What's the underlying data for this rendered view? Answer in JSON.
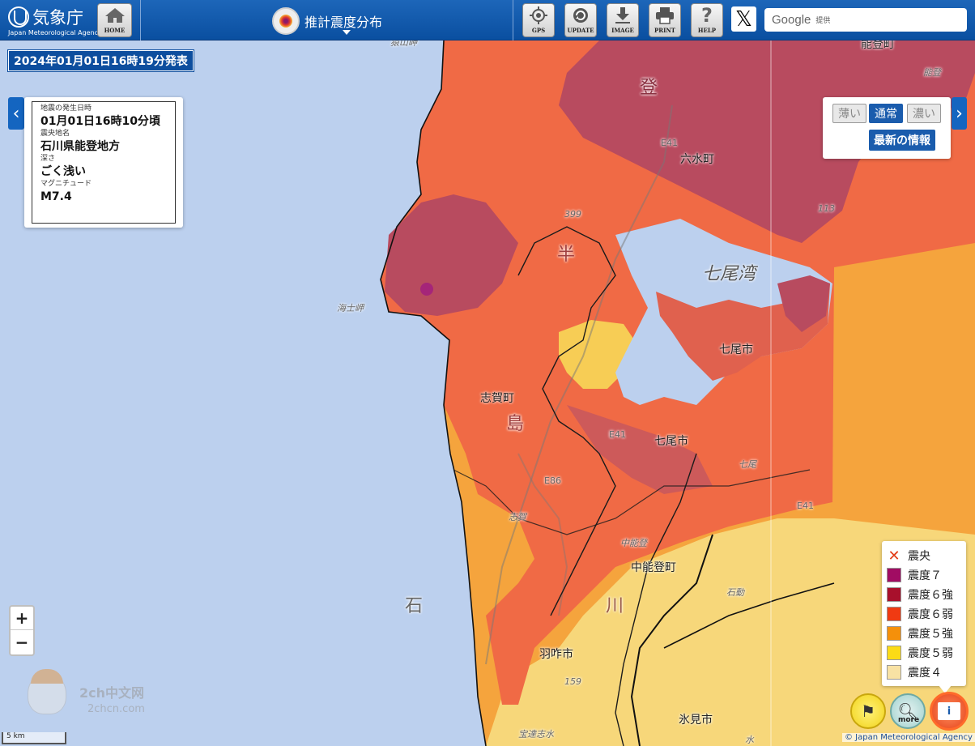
{
  "header": {
    "agency_name": "気象庁",
    "agency_name_en": "Japan Meteorological Agency",
    "home_label": "HOME",
    "title": "推計震度分布",
    "tools": [
      {
        "label": "GPS",
        "icon": "gps-icon"
      },
      {
        "label": "UPDATE",
        "icon": "update-icon"
      },
      {
        "label": "IMAGE",
        "icon": "download-icon"
      },
      {
        "label": "PRINT",
        "icon": "print-icon"
      },
      {
        "label": "HELP",
        "icon": "help-icon"
      }
    ],
    "x_icon": "x-logo-icon",
    "search_brand": "Google",
    "search_suffix": "提供"
  },
  "issued_at": "2024年01月01日16時19分発表",
  "quake": {
    "time_label": "地震の発生日時",
    "time_value": "01月01日16時10分頃",
    "epicenter_label": "震央地名",
    "epicenter_value": "石川県能登地方",
    "depth_label": "深さ",
    "depth_value": "ごく浅い",
    "magnitude_label": "マグニチュード",
    "magnitude_value": "M7.4"
  },
  "shade": {
    "light": "薄い",
    "normal": "通常",
    "dark": "濃い",
    "selected": "通常",
    "latest": "最新の情報"
  },
  "zoom": {
    "in": "+",
    "out": "−"
  },
  "map_labels": {
    "anamizu": "六水町",
    "nanao_bay": "七尾湾",
    "nanao_city_1": "七尾市",
    "nanao_city_2": "七尾市",
    "shika": "志賀町",
    "nakanoto": "中能登町",
    "hakui": "羽咋市",
    "himi": "氷見市",
    "noto_town": "能登町",
    "ishi": "石",
    "kawa": "川",
    "hanto": "半",
    "shima": "島",
    "noto": "登",
    "nanao_small": "七尾",
    "nakanoto_small": "中能登",
    "road_e41": "E41",
    "road_e86": "E86",
    "kaishi_misaki": "海士岬",
    "sarayama": "猿山岬",
    "num_399": "399",
    "num_113": "113",
    "num_159": "159",
    "shika_small": "志賀",
    "ishido": "石動",
    "notojima": "能登",
    "ujiwa": "宝達志水",
    "mizu": "水"
  },
  "legend": {
    "epicenter_label": "震央",
    "epicenter_color": "#e23b16",
    "items": [
      {
        "label": "震度７",
        "color": "#a10c63"
      },
      {
        "label": "震度６強",
        "color": "#a8102c"
      },
      {
        "label": "震度６弱",
        "color": "#f03a12"
      },
      {
        "label": "震度５強",
        "color": "#f5900a"
      },
      {
        "label": "震度５弱",
        "color": "#fbdb16"
      },
      {
        "label": "震度４",
        "color": "#f8e2a4"
      }
    ]
  },
  "round_buttons": {
    "guide_icon": "guide-icon",
    "more_label": "more",
    "legend_icon": "legend-book-icon",
    "legend_glyph": "i"
  },
  "scale_label": "5 km",
  "attribution": "© Japan Meteorological Agency",
  "watermark": {
    "line1": "2ch中文网",
    "line2": "2chcn.com"
  }
}
